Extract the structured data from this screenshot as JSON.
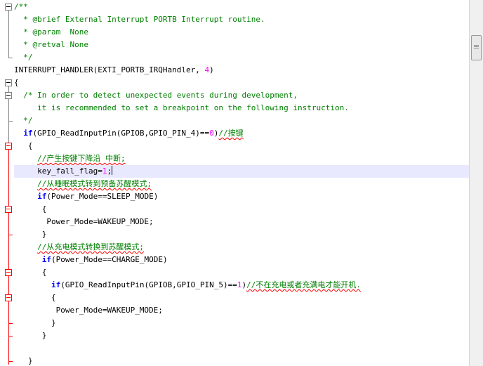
{
  "editor": {
    "lines": [
      [
        {
          "t": "/**",
          "c": "cm"
        }
      ],
      [
        {
          "t": "  * @brief External Interrupt PORTB Interrupt routine.",
          "c": "cm"
        }
      ],
      [
        {
          "t": "  * @param  None",
          "c": "cm"
        }
      ],
      [
        {
          "t": "  * @retval None",
          "c": "cm"
        }
      ],
      [
        {
          "t": "  */",
          "c": "cm"
        }
      ],
      [
        {
          "t": "INTERRUPT_HANDLER(EXTI_PORTB_IRQHandler, "
        },
        {
          "t": "4",
          "c": "num"
        },
        {
          "t": ")"
        }
      ],
      [
        {
          "t": "{"
        }
      ],
      [
        {
          "t": "  /* In order to detect unexpected events during development,",
          "c": "cm"
        }
      ],
      [
        {
          "t": "     it is recommended to set a breakpoint on the following instruction.",
          "c": "cm"
        }
      ],
      [
        {
          "t": "  */",
          "c": "cm"
        }
      ],
      [
        {
          "t": "  "
        },
        {
          "t": "if",
          "c": "kw"
        },
        {
          "t": "(GPIO_ReadInputPin(GPIOB,GPIO_PIN_4)=="
        },
        {
          "t": "0",
          "c": "num"
        },
        {
          "t": ")"
        },
        {
          "t": "//按键",
          "c": "cm",
          "s": true
        }
      ],
      [
        {
          "t": "   {"
        }
      ],
      [
        {
          "t": "     "
        },
        {
          "t": "//产生按键下降沿 中断;",
          "c": "cm",
          "s": true
        }
      ],
      [
        {
          "t": "     key_fall_flag="
        },
        {
          "t": "1",
          "c": "num"
        },
        {
          "t": ";"
        },
        {
          "caret": true
        }
      ],
      [
        {
          "t": "     "
        },
        {
          "t": "//从睡眠模式转到预备苏醒模式;",
          "c": "cm",
          "s": true
        }
      ],
      [
        {
          "t": "     "
        },
        {
          "t": "if",
          "c": "kw"
        },
        {
          "t": "(Power_Mode==SLEEP_MODE)"
        }
      ],
      [
        {
          "t": "      {"
        }
      ],
      [
        {
          "t": "       Power_Mode=WAKEUP_MODE;"
        }
      ],
      [
        {
          "t": "      }"
        }
      ],
      [
        {
          "t": "     "
        },
        {
          "t": "//从充电模式转换到苏醒模式;",
          "c": "cm",
          "s": true
        }
      ],
      [
        {
          "t": "      "
        },
        {
          "t": "if",
          "c": "kw"
        },
        {
          "t": "(Power_Mode==CHARGE_MODE)"
        }
      ],
      [
        {
          "t": "      {"
        }
      ],
      [
        {
          "t": "        "
        },
        {
          "t": "if",
          "c": "kw"
        },
        {
          "t": "(GPIO_ReadInputPin(GPIOB,GPIO_PIN_5)=="
        },
        {
          "t": "1",
          "c": "num"
        },
        {
          "t": ")"
        },
        {
          "t": "//不在充电或者充满电才能开机.",
          "c": "cm",
          "s": true
        }
      ],
      [
        {
          "t": "        {"
        }
      ],
      [
        {
          "t": "         Power_Mode=WAKEUP_MODE;"
        }
      ],
      [
        {
          "t": "        }"
        }
      ],
      [
        {
          "t": "      }"
        }
      ],
      [
        {
          "t": ""
        }
      ],
      [
        {
          "t": "   }"
        }
      ]
    ],
    "highlight_line": 13,
    "colors": {
      "comment": "#008000",
      "keyword": "#0000ff",
      "number": "#ff00ff",
      "squiggle": "#ff0000",
      "line_highlight": "#e8e8ff",
      "fold_gray": "#808080",
      "fold_red": "#ff0000"
    }
  }
}
